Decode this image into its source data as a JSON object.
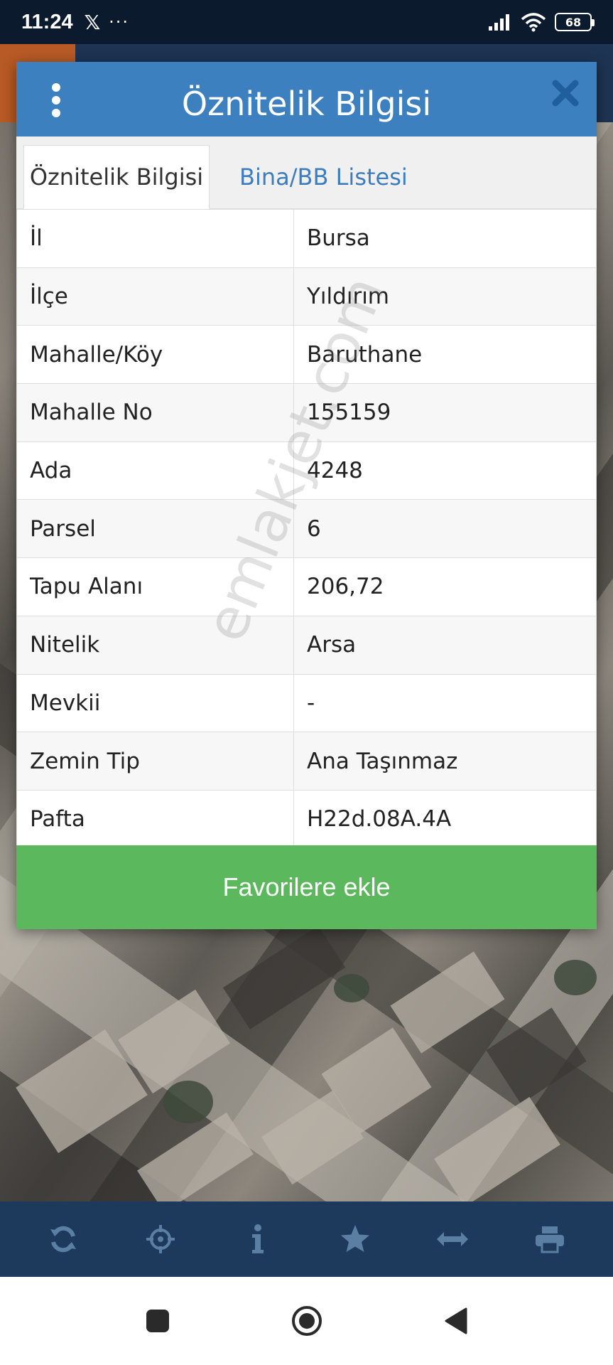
{
  "status_bar": {
    "time": "11:24",
    "x_app_glyph": "𝕏",
    "more_glyph": "···",
    "battery": "68"
  },
  "dialog": {
    "title": "Öznitelik Bilgisi",
    "tabs": [
      {
        "label": "Öznitelik Bilgisi",
        "active": true
      },
      {
        "label": "Bina/BB Listesi",
        "active": false
      }
    ],
    "rows": [
      {
        "key": "İl",
        "value": "Bursa"
      },
      {
        "key": "İlçe",
        "value": "Yıldırım"
      },
      {
        "key": "Mahalle/Köy",
        "value": "Baruthane"
      },
      {
        "key": "Mahalle No",
        "value": "155159"
      },
      {
        "key": "Ada",
        "value": "4248"
      },
      {
        "key": "Parsel",
        "value": "6"
      },
      {
        "key": "Tapu Alanı",
        "value": "206,72"
      },
      {
        "key": "Nitelik",
        "value": "Arsa"
      },
      {
        "key": "Mevkii",
        "value": "-"
      },
      {
        "key": "Zemin Tip",
        "value": "Ana Taşınmaz"
      },
      {
        "key": "Pafta",
        "value": "H22d.08A.4A"
      }
    ],
    "favorite_button": "Favorilere ekle"
  },
  "watermark": "emlakjet.com",
  "toolbar": {
    "icons": [
      "refresh-icon",
      "crosshair-icon",
      "info-icon",
      "star-icon",
      "measure-arrows-icon",
      "print-icon"
    ]
  },
  "navbar": {
    "icons": [
      "recents-square-icon",
      "home-circle-icon",
      "back-triangle-icon"
    ]
  },
  "colors": {
    "header_blue": "#3d80c0",
    "tab_link_blue": "#3d7dbf",
    "button_green": "#5cb85c",
    "toolbar_navy": "#1d3a5c",
    "status_bar": "#0b1a2c"
  }
}
